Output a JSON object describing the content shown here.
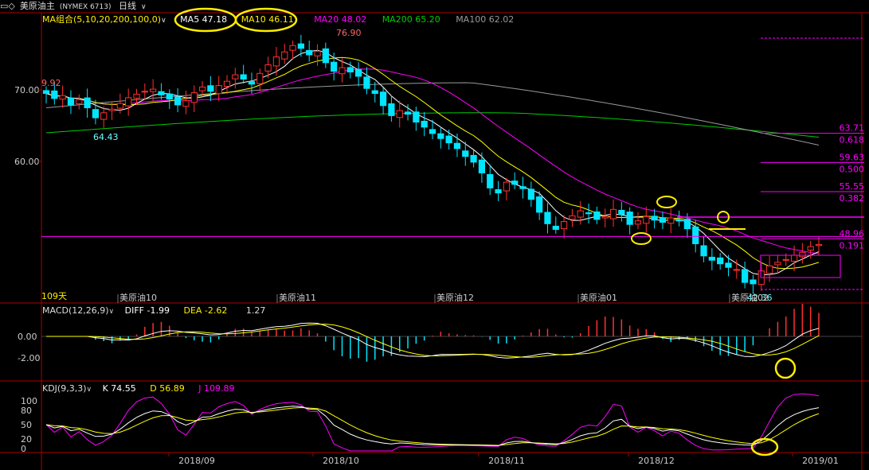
{
  "header": {
    "back_icon": "back-icon",
    "symbol_prefix": "▭◇",
    "name": "美原油主",
    "code": "(NYMEX 6713)",
    "period": "日线",
    "chevron": "∨"
  },
  "ma_panel": {
    "label": "MA组合(5,10,20,200,100,0)",
    "chevron": "∨",
    "ma5": "MA5 47.18",
    "ma10": "MA10 46.11",
    "ma20": "MA20 48.02",
    "ma200": "MA200 65.20",
    "ma100": "MA100 62.02",
    "colors": {
      "ma5": "#ffffff",
      "ma10": "#ffff00",
      "ma20": "#ff00ff",
      "ma200": "#00cc00",
      "ma100": "#999999",
      "up": "#ff3030",
      "down": "#00e5ff",
      "fib": "#ff00ff",
      "highlight": "#ffee00"
    }
  },
  "macd_panel": {
    "label": "MACD(12,26,9)",
    "chevron": "∨",
    "diff": "DIFF -1.99",
    "dea": "DEA -2.62",
    "macd": "1.27"
  },
  "kdj_panel": {
    "label": "KDJ(9,3,3)",
    "chevron": "∨",
    "k": "K 74.55",
    "d": "D 56.89",
    "j": "J 109.89"
  },
  "chart_data": {
    "type": "candlestick",
    "y_ticks": [
      "70.00",
      "60.00"
    ],
    "y_range": [
      42,
      79
    ],
    "annotations": {
      "high": "76.90",
      "left_high": "9.92",
      "low_left": "64.43",
      "low_right": "42.36"
    },
    "fib_levels": [
      {
        "price": 63.71,
        "ratio": 0.618,
        "price_label": "63.71",
        "ratio_label": "0.618"
      },
      {
        "price": 59.63,
        "ratio": 0.5,
        "price_label": "59.63",
        "ratio_label": "0.500"
      },
      {
        "price": 55.55,
        "ratio": 0.382,
        "price_label": "55.55",
        "ratio_label": "0.382"
      },
      {
        "price": 48.96,
        "ratio": 0.191,
        "price_label": "48.96",
        "ratio_label": "0.191"
      }
    ],
    "days_label": "109天",
    "contract_labels": [
      "美原油10",
      "美原油11",
      "美原油12",
      "美原油01",
      "美原油02"
    ],
    "x_labels": [
      "2018/09",
      "2018/10",
      "2018/11",
      "2018/12",
      "2019/01"
    ],
    "macd_ticks": [
      "0.00",
      "-2.00"
    ],
    "kdj_ticks": [
      "100",
      "80",
      "50",
      "20",
      "0"
    ],
    "closes": [
      69.5,
      68.8,
      69.2,
      67.9,
      68.6,
      67.5,
      66.1,
      66.8,
      67.3,
      68.1,
      68.9,
      69.4,
      69.8,
      70.1,
      69.3,
      68.7,
      67.9,
      68.5,
      69.6,
      70.4,
      69.8,
      70.6,
      71.2,
      72.1,
      71.5,
      70.8,
      72.3,
      73.5,
      74.6,
      75.3,
      76.2,
      75.8,
      74.9,
      75.4,
      73.8,
      72.6,
      73.1,
      72.5,
      71.9,
      70.2,
      69.5,
      67.8,
      66.4,
      67.1,
      66.6,
      65.5,
      64.8,
      63.9,
      63.2,
      62.6,
      61.8,
      60.7,
      59.9,
      58.4,
      56.3,
      55.6,
      57.1,
      56.8,
      56.2,
      54.7,
      52.9,
      51.3,
      50.5,
      51.6,
      52.4,
      53.1,
      52.7,
      51.9,
      52.3,
      53.3,
      52.6,
      51.2,
      51.7,
      52.3,
      51.8,
      51.5,
      52.1,
      51.7,
      50.6,
      48.5,
      46.8,
      46.2,
      45.7,
      45.2,
      44.9,
      43.1,
      42.9,
      44.7,
      45.4,
      45.9,
      46.3,
      46.9,
      47.3,
      48.1,
      48.4
    ],
    "macd_series": {
      "diff_final": -1.99,
      "dea_final": -2.62,
      "macd_final": 1.27
    },
    "kdj_series": {
      "k_final": 74.55,
      "d_final": 56.89,
      "j_final": 109.89
    }
  }
}
